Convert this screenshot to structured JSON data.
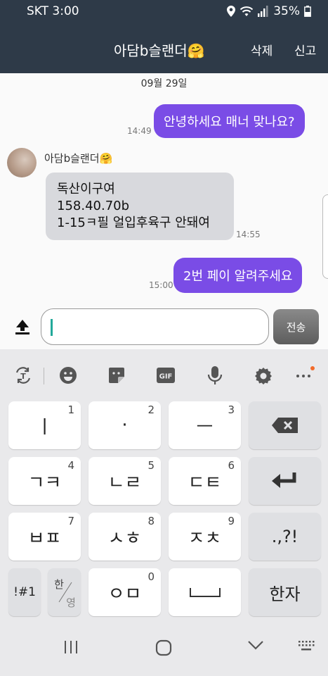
{
  "status": {
    "carrier_time": "SKT 3:00",
    "battery": "35%"
  },
  "header": {
    "title": "아담b슬랜더🤗",
    "delete_label": "삭제",
    "report_label": "신고"
  },
  "chat": {
    "date": "09월 29일",
    "messages": [
      {
        "direction": "out",
        "text": "안녕하세요 매너 맞나요?",
        "time": "14:49"
      },
      {
        "direction": "in",
        "sender": "아담b슬랜더🤗",
        "lines": [
          "독산이구여",
          "158.40.70b",
          "1-15ㅋ필 얼입후육구 안돼여"
        ],
        "time": "14:55"
      },
      {
        "direction": "out",
        "text": "2번 페이 알려주세요",
        "time": "15:00"
      }
    ]
  },
  "input": {
    "value": "",
    "send_label": "전송"
  },
  "keyboard": {
    "toolbar": [
      "translate-icon",
      "emoji-icon",
      "sticker-icon",
      "gif-icon",
      "mic-icon",
      "settings-icon",
      "more-icon"
    ],
    "gif_label": "GIF",
    "keys": [
      {
        "label": "ㅣ",
        "num": "1"
      },
      {
        "label": "·",
        "num": "2"
      },
      {
        "label": "ㅡ",
        "num": "3"
      },
      {
        "label": "ㄱㅋ",
        "num": "4"
      },
      {
        "label": "ㄴㄹ",
        "num": "5"
      },
      {
        "label": "ㄷㅌ",
        "num": "6"
      },
      {
        "label": "ㅂㅍ",
        "num": "7"
      },
      {
        "label": "ㅅㅎ",
        "num": "8"
      },
      {
        "label": "ㅈㅊ",
        "num": "9"
      },
      {
        "label": "ㅇㅁ",
        "num": "0"
      }
    ],
    "punct_label": ".,?!",
    "symbol_label": "!#1",
    "lang_top": "한",
    "lang_bottom": "영",
    "hanja_label": "한자"
  },
  "colors": {
    "header_bg": "#2e3a48",
    "bubble_out": "#7a4ce6",
    "bubble_in": "#d8d9dd",
    "caret": "#22a99a"
  }
}
